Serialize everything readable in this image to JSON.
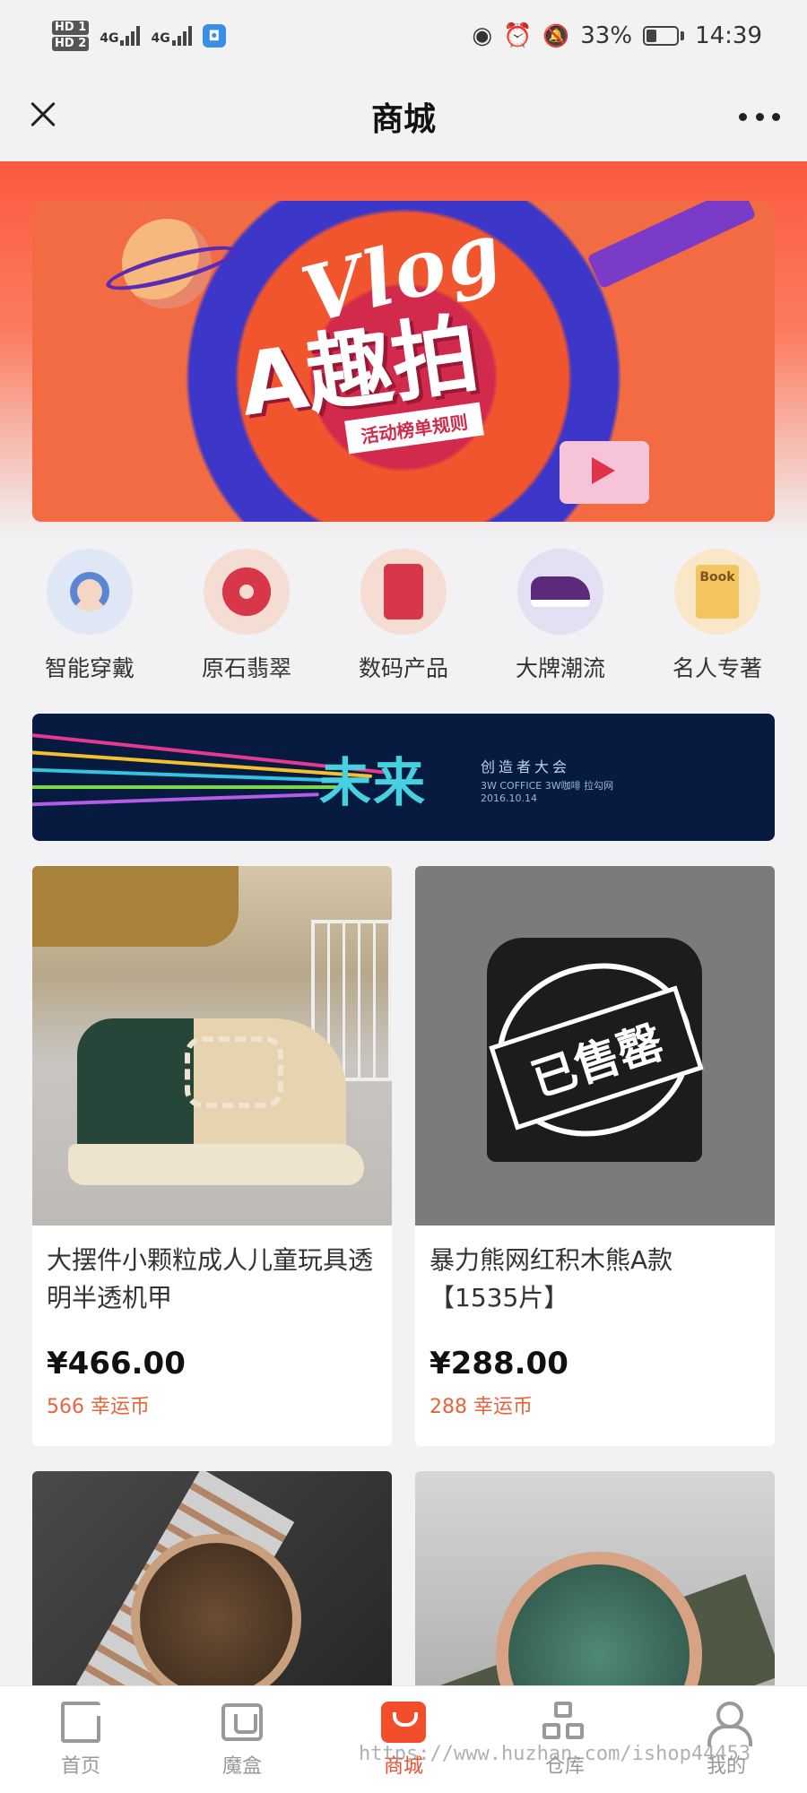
{
  "status_bar": {
    "hd1": "HD 1",
    "hd2": "HD 2",
    "net1": "4G",
    "net2": "4G",
    "battery_pct": "33%",
    "battery_level": 0.33,
    "time": "14:39"
  },
  "nav": {
    "title": "商城"
  },
  "banner": {
    "title_en": "Vlog",
    "title_cn": "A趣拍",
    "ribbon": "活动榜单规则"
  },
  "categories": [
    {
      "label": "智能穿戴",
      "icon": "smart-wear-icon"
    },
    {
      "label": "原石翡翠",
      "icon": "jade-icon"
    },
    {
      "label": "数码产品",
      "icon": "digital-icon"
    },
    {
      "label": "大牌潮流",
      "icon": "sneaker-icon"
    },
    {
      "label": "名人专著",
      "icon": "book-icon"
    }
  ],
  "promo": {
    "title": "未来",
    "subtitle": "创造者大会",
    "line2": "3W COFFICE  3W咖啡  拉勾网",
    "date": "2016.10.14"
  },
  "products": [
    {
      "title": "大摆件小颗粒成人儿童玩具透明半透机甲",
      "price": "¥466.00",
      "coins": "566 幸运币"
    },
    {
      "title": "暴力熊网红积木熊A款【1535片】",
      "price": "¥288.00",
      "coins": "288 幸运币",
      "stamp": "已售罄"
    },
    {
      "title": "",
      "price": "",
      "coins": ""
    },
    {
      "title": "",
      "price": "",
      "coins": ""
    }
  ],
  "tabs": [
    {
      "label": "首页",
      "icon": "home-icon"
    },
    {
      "label": "魔盒",
      "icon": "box-icon"
    },
    {
      "label": "商城",
      "icon": "shop-icon"
    },
    {
      "label": "仓库",
      "icon": "warehouse-icon"
    },
    {
      "label": "我的",
      "icon": "user-icon"
    }
  ],
  "colors": {
    "accent": "#f24e2c",
    "coin": "#e8643a",
    "hero_top": "#fb5a3e"
  },
  "watermark": "https://www.huzhan.com/ishop44453"
}
